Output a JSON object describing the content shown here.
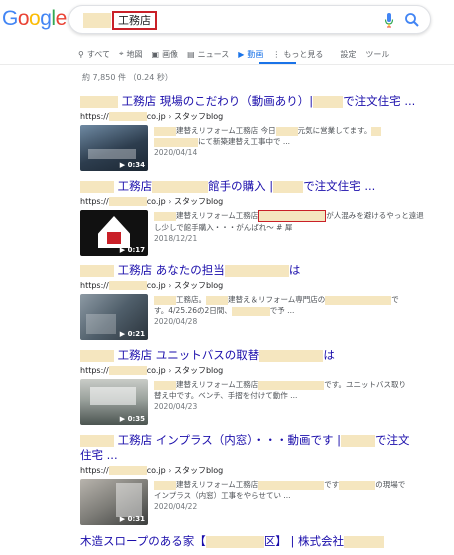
{
  "logo": "Google",
  "search": {
    "query": "工務店"
  },
  "tabs": [
    {
      "icon": "search-icon",
      "glyph": "⚲",
      "label": "すべて"
    },
    {
      "icon": "map-icon",
      "glyph": "⚲",
      "label": "地図"
    },
    {
      "icon": "image-icon",
      "glyph": "▣",
      "label": "画像"
    },
    {
      "icon": "news-icon",
      "glyph": "▤",
      "label": "ニュース"
    },
    {
      "icon": "video-icon",
      "glyph": "▶",
      "label": "動画"
    },
    {
      "icon": "more-icon",
      "glyph": "⋮",
      "label": "もっと見る"
    },
    {
      "icon": "",
      "glyph": "",
      "label": "設定"
    },
    {
      "icon": "",
      "glyph": "",
      "label": "ツール"
    }
  ],
  "stats": "約 7,850 件 （0.24 秒）",
  "results": [
    {
      "title_a": "工務店 現場のこだわり（動画あり）|",
      "title_b": "で注文住宅 ...",
      "url_prefix": "https://",
      "url_suffix": "co.jp",
      "breadcrumb": "スタッフblog",
      "snippet_1": "建替えリフォーム工務店 今日",
      "snippet_2": "元気に営業してます。",
      "snippet_3": "にて新築建替え工事中で ...",
      "date": "2020/04/14",
      "duration": "0:34"
    },
    {
      "title_a": "工務店",
      "title_b": "館手の購入 |",
      "title_c": "で注文住宅 ...",
      "url_prefix": "https://",
      "url_suffix": "co.jp",
      "breadcrumb": "スタッフblog",
      "snippet_1": "建替えリフォーム工務店",
      "snippet_2": "が人混みを避けるやっと遠退",
      "snippet_3": "し少しで館手購入・・・がんばれ〜 # 犀",
      "date": "2018/12/21",
      "duration": "0:17"
    },
    {
      "title_a": "工務店 あなたの担当",
      "title_b": "は",
      "url_prefix": "https://",
      "url_suffix": "co.jp",
      "breadcrumb": "スタッフblog",
      "snippet_1": "工務店。",
      "snippet_2": "建替え＆リフォーム専門店の",
      "snippet_3": "で",
      "snippet_4": "す。4/25.26の2日間、",
      "snippet_5": "で予 ...",
      "date": "2020/04/28",
      "duration": "0:21"
    },
    {
      "title_a": "工務店 ユニットバスの取替",
      "title_b": "は",
      "url_prefix": "https://",
      "url_suffix": "co.jp",
      "breadcrumb": "スタッフblog",
      "snippet_1": "建替えリフォーム工務店",
      "snippet_2": "です。ユニットバス取り",
      "snippet_3": "替え中です。ベンチ、手摺を付けて動作 ...",
      "date": "2020/04/23",
      "duration": "0:35"
    },
    {
      "title_a": "工務店 インプラス（内窓）・・・動画です |",
      "title_b": "で注文",
      "title_line2": "住宅 ...",
      "url_prefix": "https://",
      "url_suffix": "co.jp",
      "breadcrumb": "スタッフblog",
      "snippet_1": "建替えリフォーム工務店",
      "snippet_2": "です",
      "snippet_3": "の現場で",
      "snippet_4": "インプラス（内窓）工事をやらせてい ...",
      "date": "2020/04/22",
      "duration": "0:31"
    },
    {
      "title_a": "木造スロープのある家【",
      "title_b": "区】 | 株式会社"
    }
  ]
}
